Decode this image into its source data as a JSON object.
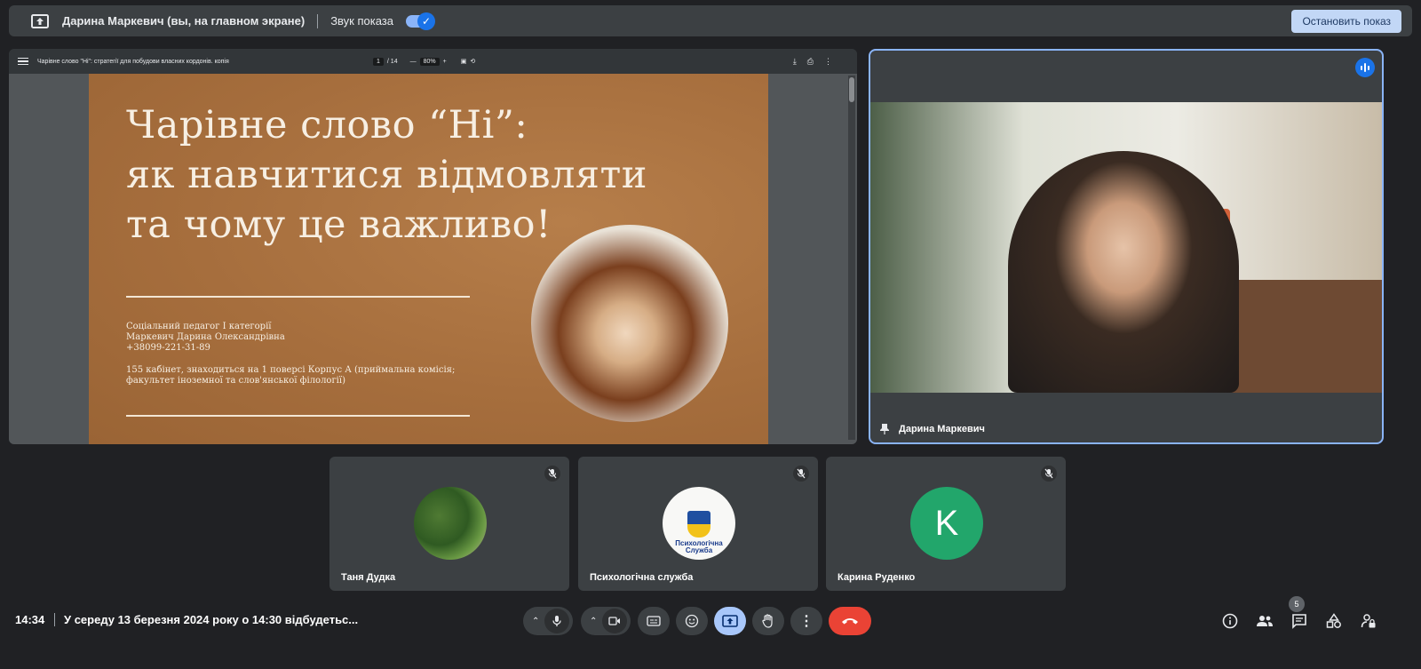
{
  "banner": {
    "presenter_label": "Дарина Маркевич (вы, на главном экране)",
    "sound_label": "Звук показа",
    "stop_button": "Остановить показ"
  },
  "pdf_viewer": {
    "doc_title": "Чарівне слово \"Ні\": стратегії для побудови власних кордонів. копія",
    "current_page": "1",
    "total_pages": "/ 14",
    "zoom": "80%"
  },
  "slide": {
    "title_line1": "Чарівне слово “Ні”:",
    "title_line2": "як навчитися відмовляти",
    "title_line3": "та чому це важливо!",
    "info_line1": "Соціальний педагог І категорії",
    "info_line2": "Маркевич Дарина Олександрівна",
    "info_line3": "+38099-221-31-89",
    "info_line4": "155 кабінет, знаходиться на 1 поверсі Корпус А (приймальна комісія;",
    "info_line5": "факультет іноземної та слов'янської філології)"
  },
  "speaker": {
    "name": "Дарина Маркевич"
  },
  "participants": [
    {
      "name": "Таня Дудка"
    },
    {
      "name": "Психологічна служба",
      "logo_text": "Психологічна Служба"
    },
    {
      "name": "Карина Руденко",
      "initial": "K"
    }
  ],
  "bottom_bar": {
    "time": "14:34",
    "meeting_title": "У середу 13 березня 2024 року о 14:30 відбудетьс...",
    "participant_count": "5"
  },
  "colors": {
    "accent": "#8ab4f8",
    "end_call": "#ea4335",
    "present_active": "#a8c7fa",
    "avatar_green": "#22a66b"
  }
}
